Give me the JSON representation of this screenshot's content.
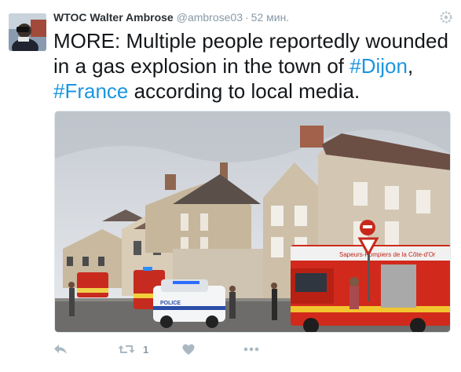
{
  "tweet": {
    "display_name": "WTOC Walter Ambrose",
    "handle": "@ambrose03",
    "separator": "·",
    "time": "52 мин.",
    "text_lead": "MORE: Multiple people reportedly wounded in a gas explosion in the town of ",
    "hashtag_1": "#Dijon",
    "text_comma": ", ",
    "hashtag_2": "#France",
    "text_tail": " according to local media.",
    "photo": {
      "sign_text": "Sapeurs-Pompiers de la Côte-d'Or",
      "police_text": "POLICE"
    }
  },
  "actions": {
    "reply_icon": "reply-icon",
    "retweet_icon": "retweet-icon",
    "retweet_count": "1",
    "like_icon": "heart-icon",
    "more_icon": "more-icon"
  },
  "colors": {
    "link": "#1b95e0",
    "muted": "#8899a6",
    "text": "#14171a"
  }
}
